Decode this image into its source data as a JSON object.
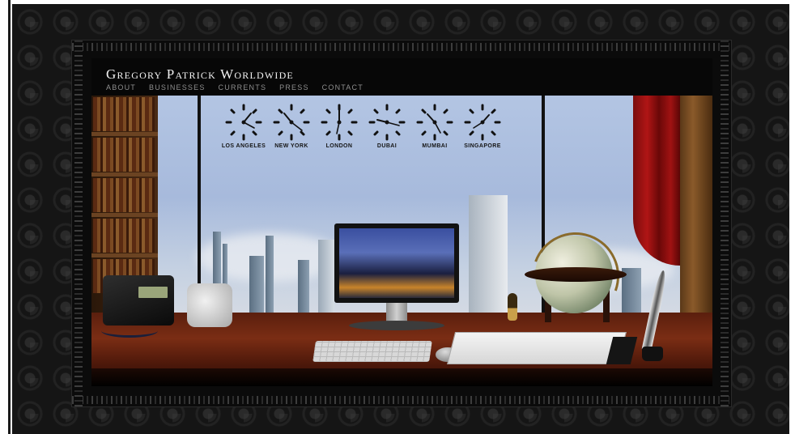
{
  "site": {
    "title": "Gregory Patrick Worldwide"
  },
  "nav": {
    "items": [
      {
        "label": "ABOUT"
      },
      {
        "label": "BUSINESSES"
      },
      {
        "label": "CURRENTS"
      },
      {
        "label": "PRESS"
      },
      {
        "label": "CONTACT"
      }
    ]
  },
  "clocks": [
    {
      "city": "LOS ANGELES"
    },
    {
      "city": "NEW YORK"
    },
    {
      "city": "LONDON"
    },
    {
      "city": "DUBAI"
    },
    {
      "city": "MUMBAI"
    },
    {
      "city": "SINGAPORE"
    }
  ],
  "colors": {
    "background": "#151515",
    "header": "#070707",
    "nav_text": "#8e8e8e",
    "title_text": "#f2f2f2",
    "desk_wood": "#7a2d14",
    "curtain": "#b01515",
    "sky": "#b3c5e3"
  }
}
